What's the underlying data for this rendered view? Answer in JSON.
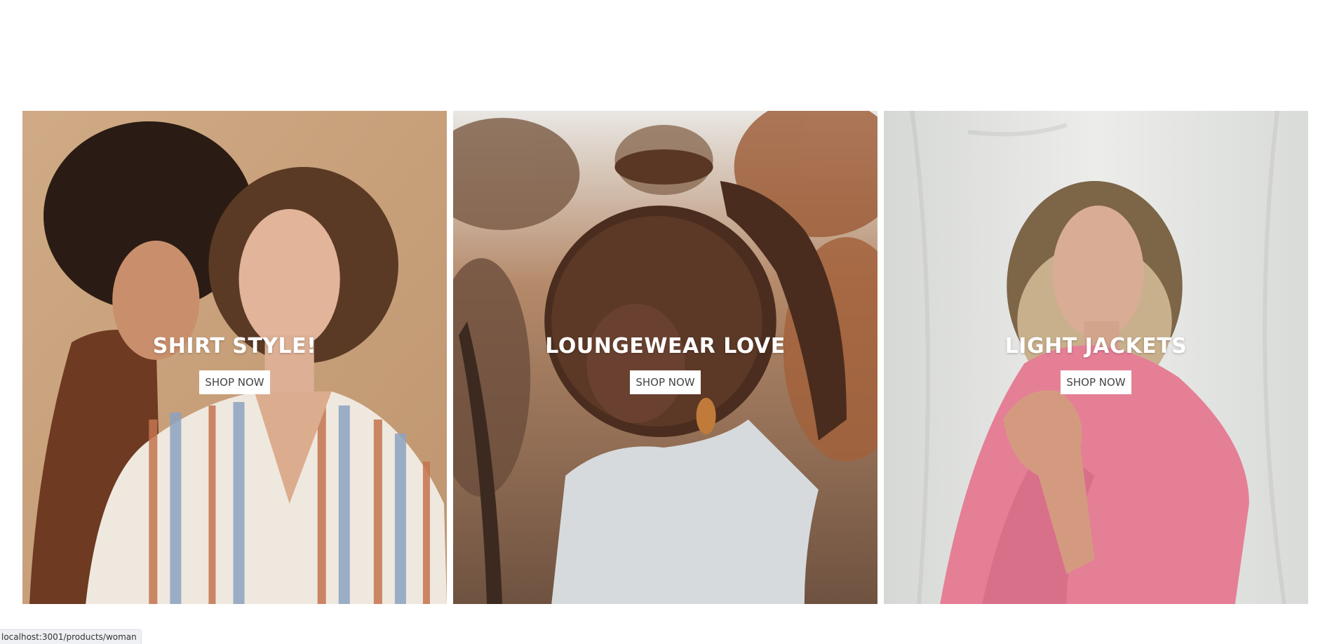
{
  "tiles": [
    {
      "title": "SHIRT STYLE!",
      "button_label": "SHOP NOW",
      "photo": "two-women-striped-shirt-photo",
      "colors": {
        "background": "#c8a27c",
        "accent": "#8a5a3c"
      }
    },
    {
      "title": "LOUNGEWEAR LOVE",
      "button_label": "SHOP NOW",
      "photo": "woman-white-tee-autumn-trees-photo",
      "colors": {
        "background": "#8a6a52",
        "accent": "#d9dde0"
      }
    },
    {
      "title": "LIGHT JACKETS",
      "button_label": "SHOP NOW",
      "photo": "woman-pink-jacket-photo",
      "colors": {
        "background": "#e4e4e2",
        "accent": "#e7869b"
      }
    }
  ],
  "status_bar": {
    "url": "localhost:3001/products/woman"
  }
}
